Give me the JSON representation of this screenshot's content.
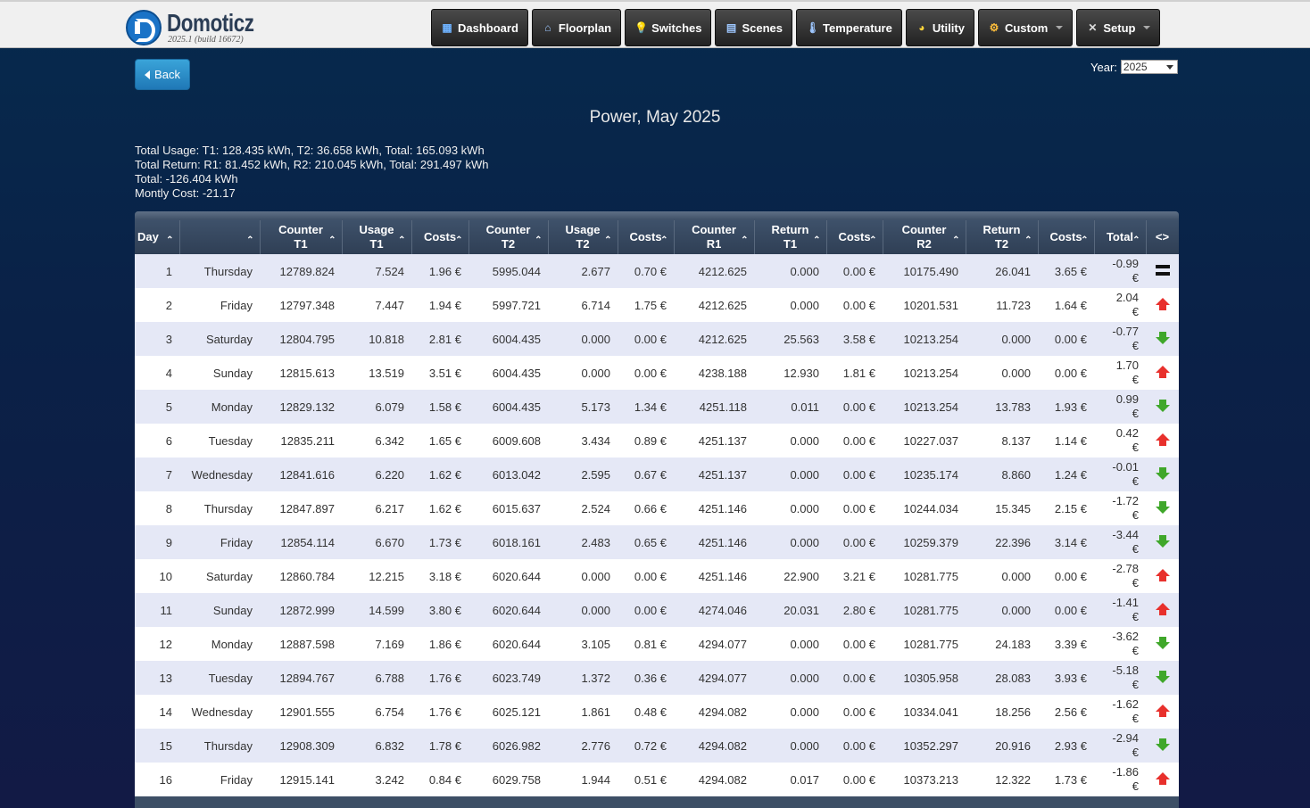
{
  "logo": {
    "name": "Domoticz",
    "version": "2025.1 (build 16672)"
  },
  "nav": [
    {
      "label": "Dashboard",
      "icon": "dashboard-icon",
      "caret": false
    },
    {
      "label": "Floorplan",
      "icon": "floorplan-icon",
      "caret": false
    },
    {
      "label": "Switches",
      "icon": "lightbulb-icon",
      "caret": false
    },
    {
      "label": "Scenes",
      "icon": "clapper-icon",
      "caret": false
    },
    {
      "label": "Temperature",
      "icon": "thermometer-icon",
      "caret": false
    },
    {
      "label": "Utility",
      "icon": "gauge-icon",
      "caret": false
    },
    {
      "label": "Custom",
      "icon": "gear-icon",
      "caret": true
    },
    {
      "label": "Setup",
      "icon": "tools-icon",
      "caret": true
    }
  ],
  "back_label": "Back",
  "year": {
    "label": "Year:",
    "value": "2025"
  },
  "title": "Power, May 2025",
  "summary": {
    "usage": "Total Usage: T1: 128.435 kWh, T2: 36.658 kWh, Total: 165.093 kWh",
    "return": "Total Return: R1: 81.452 kWh, R2: 210.045 kWh, Total: 291.497 kWh",
    "total": "Total: -126.404 kWh",
    "cost": "Montly Cost: -21.17"
  },
  "columns": [
    {
      "l1": "Day",
      "l2": ""
    },
    {
      "l1": "",
      "l2": ""
    },
    {
      "l1": "Counter",
      "l2": "T1"
    },
    {
      "l1": "Usage",
      "l2": "T1"
    },
    {
      "l1": "Costs",
      "l2": ""
    },
    {
      "l1": "Counter",
      "l2": "T2"
    },
    {
      "l1": "Usage",
      "l2": "T2"
    },
    {
      "l1": "Costs",
      "l2": ""
    },
    {
      "l1": "Counter",
      "l2": "R1"
    },
    {
      "l1": "Return",
      "l2": "T1"
    },
    {
      "l1": "Costs",
      "l2": ""
    },
    {
      "l1": "Counter",
      "l2": "R2"
    },
    {
      "l1": "Return",
      "l2": "T2"
    },
    {
      "l1": "Costs",
      "l2": ""
    },
    {
      "l1": "Total",
      "l2": ""
    },
    {
      "l1": "<>",
      "l2": ""
    }
  ],
  "rows": [
    [
      "1",
      "Thursday",
      "12789.824",
      "7.524",
      "1.96 €",
      "5995.044",
      "2.677",
      "0.70 €",
      "4212.625",
      "0.000",
      "0.00 €",
      "10175.490",
      "26.041",
      "3.65 €",
      "-0.99",
      "€",
      "equal"
    ],
    [
      "2",
      "Friday",
      "12797.348",
      "7.447",
      "1.94 €",
      "5997.721",
      "6.714",
      "1.75 €",
      "4212.625",
      "0.000",
      "0.00 €",
      "10201.531",
      "11.723",
      "1.64 €",
      "2.04",
      "€",
      "up"
    ],
    [
      "3",
      "Saturday",
      "12804.795",
      "10.818",
      "2.81 €",
      "6004.435",
      "0.000",
      "0.00 €",
      "4212.625",
      "25.563",
      "3.58 €",
      "10213.254",
      "0.000",
      "0.00 €",
      "-0.77",
      "€",
      "down"
    ],
    [
      "4",
      "Sunday",
      "12815.613",
      "13.519",
      "3.51 €",
      "6004.435",
      "0.000",
      "0.00 €",
      "4238.188",
      "12.930",
      "1.81 €",
      "10213.254",
      "0.000",
      "0.00 €",
      "1.70",
      "€",
      "up"
    ],
    [
      "5",
      "Monday",
      "12829.132",
      "6.079",
      "1.58 €",
      "6004.435",
      "5.173",
      "1.34 €",
      "4251.118",
      "0.011",
      "0.00 €",
      "10213.254",
      "13.783",
      "1.93 €",
      "0.99",
      "€",
      "down"
    ],
    [
      "6",
      "Tuesday",
      "12835.211",
      "6.342",
      "1.65 €",
      "6009.608",
      "3.434",
      "0.89 €",
      "4251.137",
      "0.000",
      "0.00 €",
      "10227.037",
      "8.137",
      "1.14 €",
      "0.42",
      "€",
      "up"
    ],
    [
      "7",
      "Wednesday",
      "12841.616",
      "6.220",
      "1.62 €",
      "6013.042",
      "2.595",
      "0.67 €",
      "4251.137",
      "0.000",
      "0.00 €",
      "10235.174",
      "8.860",
      "1.24 €",
      "-0.01",
      "€",
      "down"
    ],
    [
      "8",
      "Thursday",
      "12847.897",
      "6.217",
      "1.62 €",
      "6015.637",
      "2.524",
      "0.66 €",
      "4251.146",
      "0.000",
      "0.00 €",
      "10244.034",
      "15.345",
      "2.15 €",
      "-1.72",
      "€",
      "down"
    ],
    [
      "9",
      "Friday",
      "12854.114",
      "6.670",
      "1.73 €",
      "6018.161",
      "2.483",
      "0.65 €",
      "4251.146",
      "0.000",
      "0.00 €",
      "10259.379",
      "22.396",
      "3.14 €",
      "-3.44",
      "€",
      "down"
    ],
    [
      "10",
      "Saturday",
      "12860.784",
      "12.215",
      "3.18 €",
      "6020.644",
      "0.000",
      "0.00 €",
      "4251.146",
      "22.900",
      "3.21 €",
      "10281.775",
      "0.000",
      "0.00 €",
      "-2.78",
      "€",
      "up"
    ],
    [
      "11",
      "Sunday",
      "12872.999",
      "14.599",
      "3.80 €",
      "6020.644",
      "0.000",
      "0.00 €",
      "4274.046",
      "20.031",
      "2.80 €",
      "10281.775",
      "0.000",
      "0.00 €",
      "-1.41",
      "€",
      "up"
    ],
    [
      "12",
      "Monday",
      "12887.598",
      "7.169",
      "1.86 €",
      "6020.644",
      "3.105",
      "0.81 €",
      "4294.077",
      "0.000",
      "0.00 €",
      "10281.775",
      "24.183",
      "3.39 €",
      "-3.62",
      "€",
      "down"
    ],
    [
      "13",
      "Tuesday",
      "12894.767",
      "6.788",
      "1.76 €",
      "6023.749",
      "1.372",
      "0.36 €",
      "4294.077",
      "0.000",
      "0.00 €",
      "10305.958",
      "28.083",
      "3.93 €",
      "-5.18",
      "€",
      "down"
    ],
    [
      "14",
      "Wednesday",
      "12901.555",
      "6.754",
      "1.76 €",
      "6025.121",
      "1.861",
      "0.48 €",
      "4294.082",
      "0.000",
      "0.00 €",
      "10334.041",
      "18.256",
      "2.56 €",
      "-1.62",
      "€",
      "up"
    ],
    [
      "15",
      "Thursday",
      "12908.309",
      "6.832",
      "1.78 €",
      "6026.982",
      "2.776",
      "0.72 €",
      "4294.082",
      "0.000",
      "0.00 €",
      "10352.297",
      "20.916",
      "2.93 €",
      "-2.94",
      "€",
      "down"
    ],
    [
      "16",
      "Friday",
      "12915.141",
      "3.242",
      "0.84 €",
      "6029.758",
      "1.944",
      "0.51 €",
      "4294.082",
      "0.017",
      "0.00 €",
      "10373.213",
      "12.322",
      "1.73 €",
      "-1.86",
      "€",
      "up"
    ]
  ]
}
